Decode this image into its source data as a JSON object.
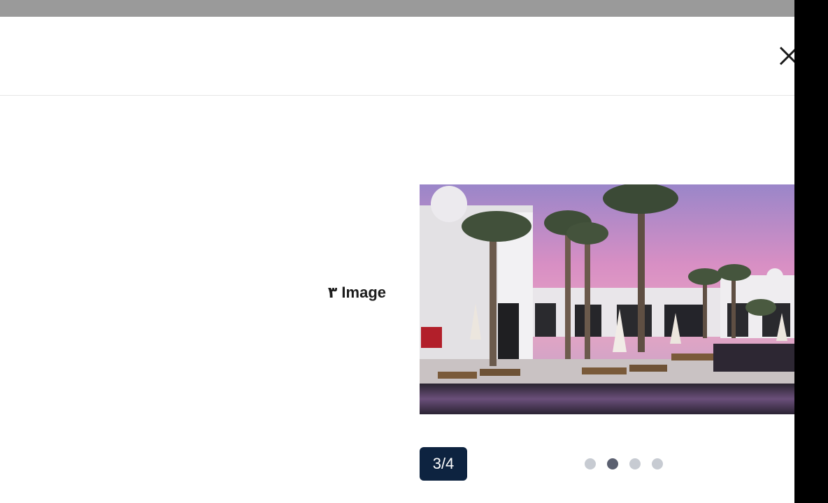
{
  "modal": {
    "close_icon": "close-icon"
  },
  "gallery": {
    "caption": "٣ Image",
    "counter": "3/4",
    "current": 3,
    "total": 4,
    "active_dot_index": 1,
    "photo_description_icon": "photo-resort-pool"
  },
  "colors": {
    "counter_bg": "#0d2340",
    "dot_active": "#5b6070",
    "dot_inactive": "#c7cbd2"
  }
}
